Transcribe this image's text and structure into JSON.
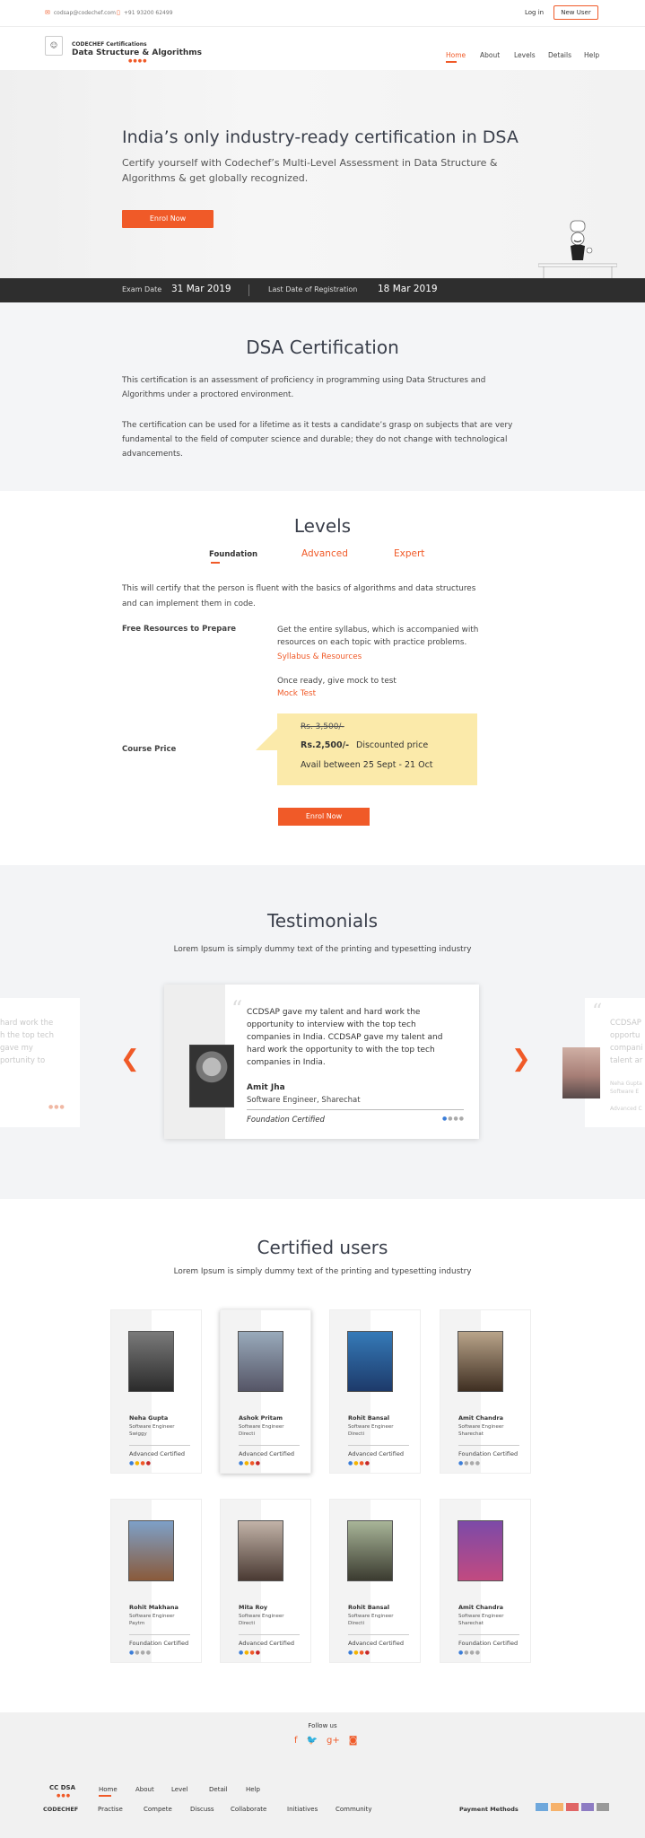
{
  "topbar": {
    "email": "codsap@codechef.com",
    "phone": "+91 93200 62499",
    "login": "Log in",
    "new_user": "New User"
  },
  "header": {
    "logo_brand": "CODECHEF Certifications",
    "logo_title": "Data Structure & Algorithms",
    "nav": [
      "Home",
      "About",
      "Levels",
      "Details",
      "Help"
    ]
  },
  "hero": {
    "title": "India’s only industry-ready certification in DSA",
    "subtitle": "Certify yourself with Codechef’s Multi-Level Assessment in Data Structure & Algorithms & get globally recognized.",
    "enrol": "Enrol Now",
    "exam_date_label": "Exam Date",
    "exam_date": "31 Mar 2019",
    "reg_label": "Last Date of Registration",
    "reg_date": "18 Mar 2019"
  },
  "dsa": {
    "title": "DSA Certification",
    "para1": "This certification is an assessment of proficiency in programming using Data Structures and Algorithms under a proctored environment.",
    "para2": "The certification can be used for a lifetime as it tests a candidate’s grasp on subjects that are very fundamental to the field of computer science and durable; they do not change with technological advancements."
  },
  "levels": {
    "title": "Levels",
    "tabs": [
      "Foundation",
      "Advanced",
      "Expert"
    ],
    "desc": "This will certify that the person is fluent with the basics of algorithms and data structures and can implement them in code.",
    "resources_label": "Free Resources to Prepare",
    "resources_text": "Get the entire syllabus, which is accompanied with resources on each topic with practice problems.",
    "syllabus_link": "Syllabus & Resources",
    "mock_text": "Once ready, give mock to test",
    "mock_link": "Mock Test",
    "price_label": "Course Price",
    "old_price": "Rs. 3,500/-",
    "new_price": "Rs.2,500/-",
    "discount": "Discounted price",
    "avail": "Avail between 25 Sept - 21 Oct",
    "enrol": "Enrol Now"
  },
  "testimonials": {
    "title": "Testimonials",
    "subtitle": "Lorem Ipsum is simply dummy text of the printing and typesetting industry",
    "quote": "CCDSAP gave my talent and hard work the opportunity to interview with the top tech companies in India. CCDSAP gave my talent and hard work the opportunity to with the top tech companies in India.",
    "name": "Amit Jha",
    "role": "Software Engineer, Sharechat",
    "cert": "Foundation Certified",
    "left_peek": [
      "hard work the",
      "h the top tech",
      "gave my",
      "portunity to"
    ],
    "right_peek": [
      "CCDSAP",
      "opportu",
      "compani",
      "talent ar"
    ],
    "right_name": "Neha Gupta",
    "right_role": "Software E",
    "right_cert": "Advanced C"
  },
  "certified": {
    "title": "Certified users",
    "subtitle": "Lorem Ipsum is simply dummy text of the printing and typesetting industry",
    "users": [
      {
        "name": "Neha Gupta",
        "role": "Software Engineer",
        "company": "Swiggy",
        "cert": "Advanced Certified"
      },
      {
        "name": "Ashok Pritam",
        "role": "Software Engineer",
        "company": "Directi",
        "cert": "Advanced Certified"
      },
      {
        "name": "Rohit Bansal",
        "role": "Software Engineer",
        "company": "Directi",
        "cert": "Advanced Certified"
      },
      {
        "name": "Amit Chandra",
        "role": "Software Engineer",
        "company": "Sharechat",
        "cert": "Foundation Certified"
      },
      {
        "name": "Rohit Makhana",
        "role": "Software Engineer",
        "company": "Paytm",
        "cert": "Foundation Certified"
      },
      {
        "name": "Mita Roy",
        "role": "Software Engineer",
        "company": "Directi",
        "cert": "Advanced Certified"
      },
      {
        "name": "Rohit Bansal",
        "role": "Software Engineer",
        "company": "Directi",
        "cert": "Advanced Certified"
      },
      {
        "name": "Amit Chandra",
        "role": "Software Engineer",
        "company": "Sharechat",
        "cert": "Foundation Certified"
      }
    ]
  },
  "footer": {
    "follow": "Follow us",
    "logo1": "CC DSA",
    "logo2": "CODECHEF",
    "nav1": [
      "Home",
      "About",
      "Level",
      "Detail",
      "Help"
    ],
    "nav2": [
      "Practise",
      "Compete",
      "Discuss",
      "Collaborate",
      "Initiatives",
      "Community"
    ],
    "payment": "Payment Methods"
  },
  "colors": {
    "accent": "#f05a28",
    "dark_bar": "#2e2e2e",
    "price_box": "#fbeaaa"
  }
}
